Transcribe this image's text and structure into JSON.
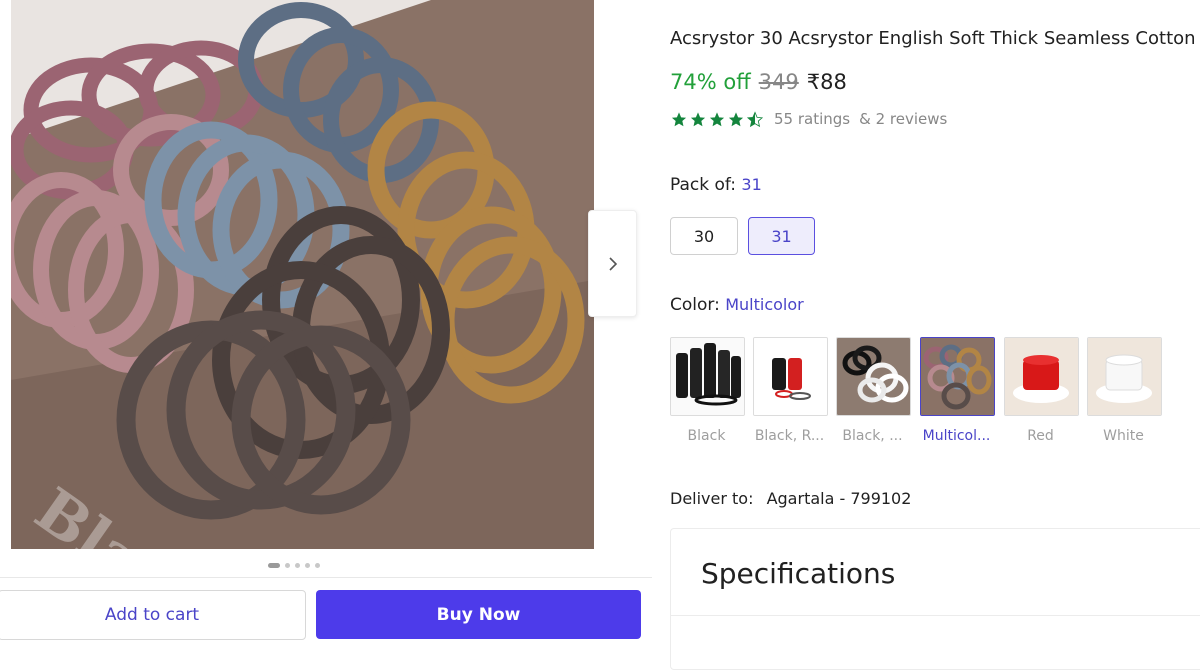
{
  "product": {
    "title": "Acsrystor 30 Acsrystor English Soft Thick Seamless Cotton",
    "discount": "74% off",
    "mrp": "349",
    "price": "₹88",
    "ratings": "55 ratings",
    "reviews": "& 2 reviews",
    "rating_stars": 4.5
  },
  "gallery": {
    "image_icon": "hair-ties-product-photo",
    "next_icon": "chevron-right-icon",
    "watermark_text": "Black.e"
  },
  "pack": {
    "label": "Pack of:",
    "selected": "31",
    "options": [
      "30",
      "31"
    ]
  },
  "color": {
    "label": "Color:",
    "selected": "Multicolor",
    "options": [
      {
        "label": "Black"
      },
      {
        "label": "Black, R..."
      },
      {
        "label": "Black, ..."
      },
      {
        "label": "Multicol..."
      },
      {
        "label": "Red"
      },
      {
        "label": "White"
      }
    ]
  },
  "delivery": {
    "label": "Deliver to:",
    "location": "Agartala - 799102"
  },
  "specs": {
    "title": "Specifications"
  },
  "actions": {
    "add_to_cart": "Add to cart",
    "buy_now": "Buy Now"
  },
  "colors": {
    "accent": "#4d3bea",
    "discount_green": "#22a03a",
    "star_green": "#14853d"
  }
}
